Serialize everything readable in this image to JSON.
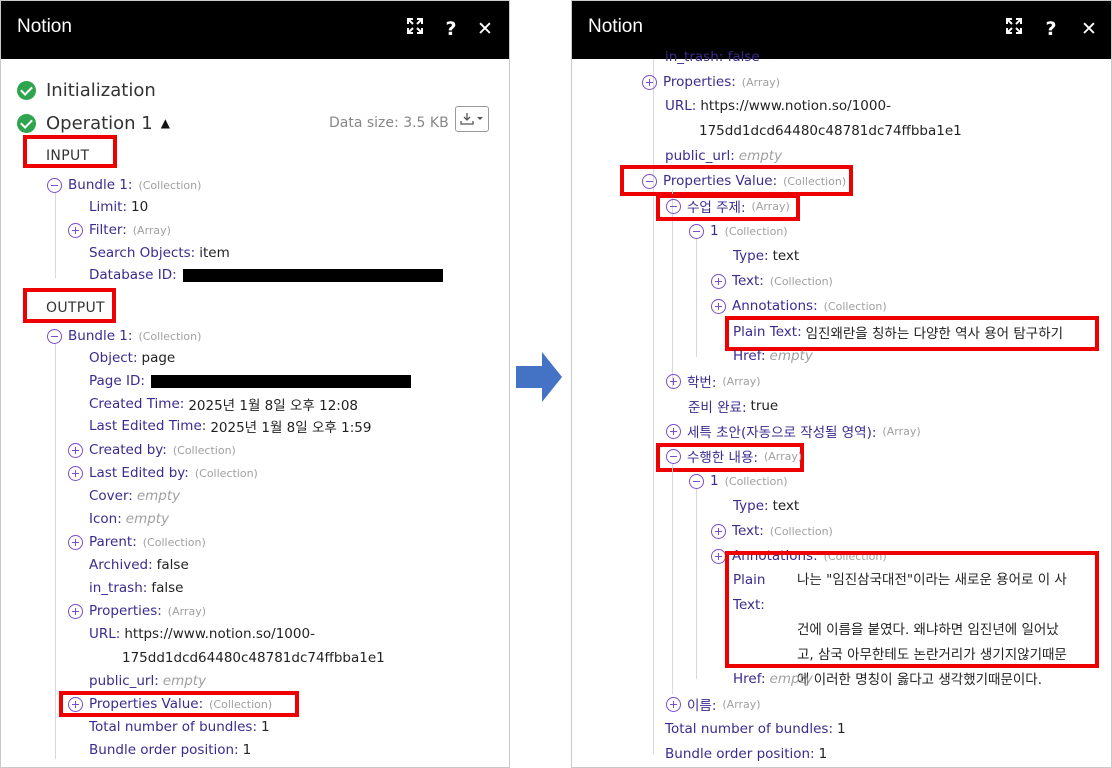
{
  "left": {
    "title": "Notion",
    "initialization": "Initialization",
    "operation": "Operation 1",
    "data_size": "Data size: 3.5 KB",
    "input_label": "INPUT",
    "output_label": "OUTPUT",
    "input": {
      "bundle": "Bundle 1:",
      "bundle_tag": "(Collection)",
      "limit_k": "Limit:",
      "limit_v": "10",
      "filter_k": "Filter:",
      "filter_tag": "(Array)",
      "search_k": "Search Objects:",
      "search_v": "item",
      "db_k": "Database ID:"
    },
    "output": {
      "bundle": "Bundle 1:",
      "bundle_tag": "(Collection)",
      "object_k": "Object:",
      "object_v": "page",
      "pageid_k": "Page ID:",
      "created_k": "Created Time:",
      "created_v": "2025년 1월 8일 오후 12:08",
      "edited_k": "Last Edited Time:",
      "edited_v": "2025년 1월 8일 오후 1:59",
      "createdby_k": "Created by:",
      "createdby_tag": "(Collection)",
      "editedby_k": "Last Edited by:",
      "editedby_tag": "(Collection)",
      "cover_k": "Cover:",
      "cover_v": "empty",
      "icon_k": "Icon:",
      "icon_v": "empty",
      "parent_k": "Parent:",
      "parent_tag": "(Collection)",
      "archived_k": "Archived:",
      "archived_v": "false",
      "trash_k": "in_trash:",
      "trash_v": "false",
      "props_k": "Properties:",
      "props_tag": "(Array)",
      "url_k": "URL:",
      "url_v1": "https://www.notion.so/1000-",
      "url_v2": "175dd1dcd64480c48781dc74ffbba1e1",
      "public_k": "public_url:",
      "public_v": "empty",
      "pv_k": "Properties Value:",
      "pv_tag": "(Collection)",
      "total_k": "Total number of bundles:",
      "total_v": "1",
      "order_k": "Bundle order position:",
      "order_v": "1"
    }
  },
  "right": {
    "title": "Notion",
    "top_cut": "in_trash: false",
    "props_k": "Properties:",
    "props_tag": "(Array)",
    "url_k": "URL:",
    "url_v1": "https://www.notion.so/1000-",
    "url_v2": "175dd1dcd64480c48781dc74ffbba1e1",
    "public_k": "public_url:",
    "public_v": "empty",
    "pv_k": "Properties Value:",
    "pv_tag": "(Collection)",
    "topic_k": "수업 주제:",
    "topic_tag": "(Array)",
    "item1_k": "1",
    "item1_tag": "(Collection)",
    "type_k": "Type:",
    "type_v": "text",
    "text_k": "Text:",
    "text_tag": "(Collection)",
    "ann_k": "Annotations:",
    "ann_tag": "(Collection)",
    "plain1_k": "Plain Text:",
    "plain1_v": "임진왜란을 칭하는 다양한 역사 용어 탐구하기",
    "href_k": "Href:",
    "href_v": "empty",
    "student_k": "학번:",
    "student_tag": "(Array)",
    "ready_k": "준비 완료:",
    "ready_v": "true",
    "draft_k": "세특 초안(자동으로 작성될 영역):",
    "draft_tag": "(Array)",
    "done_k": "수행한 내용:",
    "done_tag": "(Array)",
    "item2_k": "1",
    "item2_tag": "(Collection)",
    "type2_k": "Type:",
    "type2_v": "text",
    "text2_k": "Text:",
    "text2_tag": "(Collection)",
    "ann2_k": "Annotations:",
    "ann2_tag": "(Collection)",
    "plain2_k": "Plain Text:",
    "plain2_lines": [
      "나는 \"임진삼국대전\"이라는 새로운 용어로 이 사",
      "건에 이름을 붙였다. 왜냐하면 임진년에 일어났",
      "고, 삼국 아무한테도 논란거리가 생기지않기때문",
      "에 이러한 명칭이 옳다고 생각했기때문이다."
    ],
    "href2_k": "Href:",
    "href2_v": "empty",
    "name_k": "이름:",
    "name_tag": "(Array)",
    "total_k": "Total number of bundles:",
    "total_v": "1",
    "order_k": "Bundle order position:",
    "order_v": "1"
  },
  "colors": {
    "header": "#000000",
    "accent": "#7a4ed0",
    "key": "#3b2b8f",
    "highlight": "#ee0000",
    "success": "#2ea44f",
    "arrow": "#4472c4"
  }
}
